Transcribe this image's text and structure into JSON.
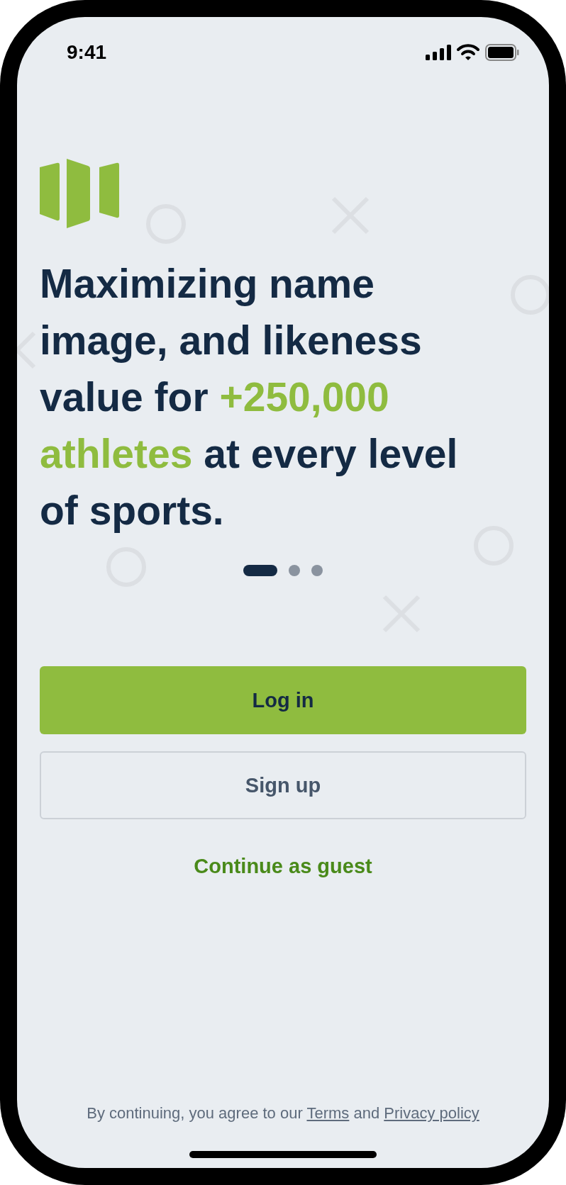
{
  "status_bar": {
    "time": "9:41"
  },
  "headline": [
    {
      "text": "Maximizing name image, and likeness value for ",
      "highlight": false
    },
    {
      "text": "+250,000 athletes",
      "highlight": true
    },
    {
      "text": " at every level of sports.",
      "highlight": false
    }
  ],
  "pager": [
    {
      "selected": true
    },
    {
      "selected": false
    },
    {
      "selected": false
    }
  ],
  "buttons": [
    {
      "label": "Log in",
      "kind": "primary"
    },
    {
      "label": "Sign up",
      "kind": "outline"
    },
    {
      "label": "Continue as guest",
      "kind": "text"
    }
  ],
  "footer": {
    "text": "By continuing, you agree to our",
    "terms": "Terms",
    "and": "and",
    "privacy": "Privacy policy"
  }
}
